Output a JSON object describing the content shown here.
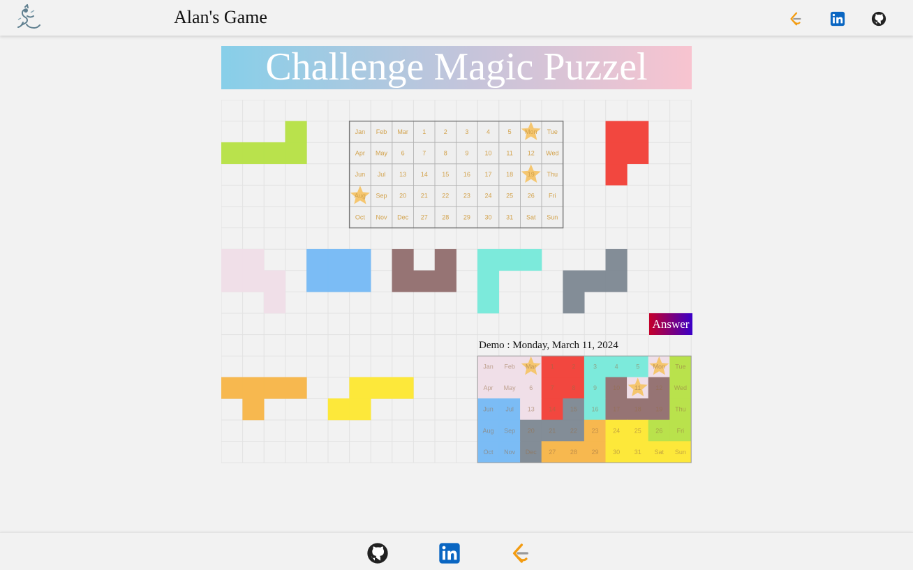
{
  "header": {
    "title": "Alan's Game",
    "icons": [
      "leetcode-icon",
      "linkedin-icon",
      "github-icon"
    ]
  },
  "banner": {
    "title": "Challenge Magic Puzzel"
  },
  "calendar": {
    "rows": [
      [
        "Jan",
        "Feb",
        "Mar",
        "1",
        "2",
        "3",
        "4",
        "5",
        "Mon",
        "Tue"
      ],
      [
        "Apr",
        "May",
        "6",
        "7",
        "8",
        "9",
        "10",
        "11",
        "12",
        "Wed"
      ],
      [
        "Jun",
        "Jul",
        "13",
        "14",
        "15",
        "16",
        "17",
        "18",
        "19",
        "Thu"
      ],
      [
        "Aug",
        "Sep",
        "20",
        "21",
        "22",
        "23",
        "24",
        "25",
        "26",
        "Fri"
      ],
      [
        "Oct",
        "Nov",
        "Dec",
        "27",
        "28",
        "29",
        "30",
        "31",
        "Sat",
        "Sun"
      ]
    ],
    "starred": [
      "Mon",
      "19",
      "Aug"
    ]
  },
  "answer_button": "Answer",
  "demo": {
    "title": "Demo : Monday, March 11, 2024",
    "starred": [
      "Mar",
      "Mon",
      "11"
    ],
    "colors": [
      [
        "#f0dfe8",
        "#f0dfe8",
        "#f0dfe8",
        "#f2473f",
        "#f2473f",
        "#7ceadb",
        "#7ceadb",
        "#7ceadb",
        "#f0dfe8",
        "#b9e24c"
      ],
      [
        "#f0dfe8",
        "#f0dfe8",
        "#f0dfe8",
        "#f2473f",
        "#f2473f",
        "#7ceadb",
        "#967474",
        "#f0dfe8",
        "#967474",
        "#b9e24c"
      ],
      [
        "#7bbcf5",
        "#7bbcf5",
        "#f0dfe8",
        "#f2473f",
        "#838d97",
        "#7ceadb",
        "#967474",
        "#967474",
        "#967474",
        "#b9e24c"
      ],
      [
        "#7bbcf5",
        "#7bbcf5",
        "#838d97",
        "#838d97",
        "#838d97",
        "#f7b84f",
        "#fde83a",
        "#fde83a",
        "#b9e24c",
        "#b9e24c"
      ],
      [
        "#7bbcf5",
        "#7bbcf5",
        "#838d97",
        "#f7b84f",
        "#f7b84f",
        "#f7b84f",
        "#fde83a",
        "#fde83a",
        "#fde83a",
        "#fde83a"
      ]
    ]
  },
  "pieces": [
    {
      "name": "piece-lime",
      "color": "#b9e24c",
      "cells": [
        [
          0,
          1
        ],
        [
          1,
          1
        ],
        [
          2,
          1
        ],
        [
          3,
          1
        ],
        [
          3,
          0
        ]
      ]
    },
    {
      "name": "piece-red",
      "color": "#f2473f",
      "cells": [
        [
          0,
          0
        ],
        [
          1,
          0
        ],
        [
          0,
          1
        ],
        [
          1,
          1
        ],
        [
          0,
          2
        ]
      ]
    },
    {
      "name": "piece-pink",
      "color": "#f0dfe8",
      "cells": [
        [
          0,
          0
        ],
        [
          1,
          0
        ],
        [
          0,
          1
        ],
        [
          1,
          1
        ],
        [
          2,
          1
        ],
        [
          2,
          2
        ]
      ]
    },
    {
      "name": "piece-blue",
      "color": "#7bbcf5",
      "cells": [
        [
          0,
          0
        ],
        [
          1,
          0
        ],
        [
          2,
          0
        ],
        [
          0,
          1
        ],
        [
          1,
          1
        ],
        [
          2,
          1
        ]
      ]
    },
    {
      "name": "piece-brown",
      "color": "#967474",
      "cells": [
        [
          0,
          0
        ],
        [
          2,
          0
        ],
        [
          0,
          1
        ],
        [
          1,
          1
        ],
        [
          2,
          1
        ]
      ]
    },
    {
      "name": "piece-teal",
      "color": "#7ceadb",
      "cells": [
        [
          0,
          0
        ],
        [
          1,
          0
        ],
        [
          2,
          0
        ],
        [
          0,
          1
        ],
        [
          0,
          2
        ]
      ]
    },
    {
      "name": "piece-gray",
      "color": "#838d97",
      "cells": [
        [
          2,
          0
        ],
        [
          0,
          1
        ],
        [
          1,
          1
        ],
        [
          2,
          1
        ],
        [
          0,
          2
        ]
      ]
    },
    {
      "name": "piece-orange",
      "color": "#f7b84f",
      "cells": [
        [
          0,
          0
        ],
        [
          1,
          0
        ],
        [
          2,
          0
        ],
        [
          3,
          0
        ],
        [
          1,
          1
        ]
      ]
    },
    {
      "name": "piece-yellow",
      "color": "#fde83a",
      "cells": [
        [
          1,
          0
        ],
        [
          2,
          0
        ],
        [
          3,
          0
        ],
        [
          0,
          1
        ],
        [
          1,
          1
        ]
      ]
    }
  ],
  "footer": {
    "icons": [
      "github-icon",
      "linkedin-icon",
      "leetcode-icon"
    ]
  },
  "colors": {
    "star": "#f5c66f",
    "calendar_text": "#d2a24c",
    "grid_line": "#e2e2e2"
  }
}
